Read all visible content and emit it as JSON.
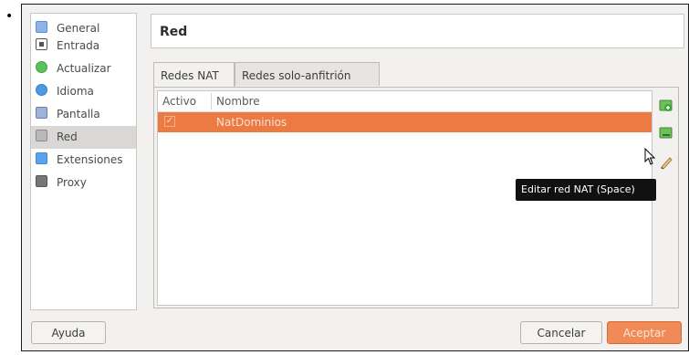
{
  "bullet": "•",
  "sidebar": {
    "items": [
      {
        "label": "General",
        "icon": "monitor-icon",
        "color": "#5b8fd6"
      },
      {
        "label": "Entrada",
        "icon": "input-icon",
        "color": "#555555"
      },
      {
        "label": "Actualizar",
        "icon": "update-icon",
        "color": "#3aa63a"
      },
      {
        "label": "Idioma",
        "icon": "globe-icon",
        "color": "#3b7fd1"
      },
      {
        "label": "Pantalla",
        "icon": "display-icon",
        "color": "#6a7fb0"
      },
      {
        "label": "Red",
        "icon": "network-icon",
        "color": "#8a8a8a"
      },
      {
        "label": "Extensiones",
        "icon": "extensions-icon",
        "color": "#3f8ae0"
      },
      {
        "label": "Proxy",
        "icon": "proxy-icon",
        "color": "#555555"
      }
    ],
    "selected": "Red"
  },
  "header": {
    "title": "Red"
  },
  "tabs": [
    {
      "label": "Redes NAT",
      "active": true
    },
    {
      "label": "Redes solo-anfitrión",
      "active": false
    }
  ],
  "table": {
    "columns": [
      "Activo",
      "Nombre"
    ],
    "rows": [
      {
        "active": true,
        "name": "NatDominios",
        "selected": true
      }
    ]
  },
  "side_buttons": [
    {
      "icon": "add-network-icon"
    },
    {
      "icon": "remove-network-icon"
    },
    {
      "icon": "edit-network-icon"
    }
  ],
  "tooltip": "Editar red NAT (Space)",
  "buttons": {
    "help": "Ayuda",
    "cancel": "Cancelar",
    "ok": "Aceptar"
  },
  "colors": {
    "accent": "#ec7b43",
    "tooltip_bg": "#111111"
  }
}
